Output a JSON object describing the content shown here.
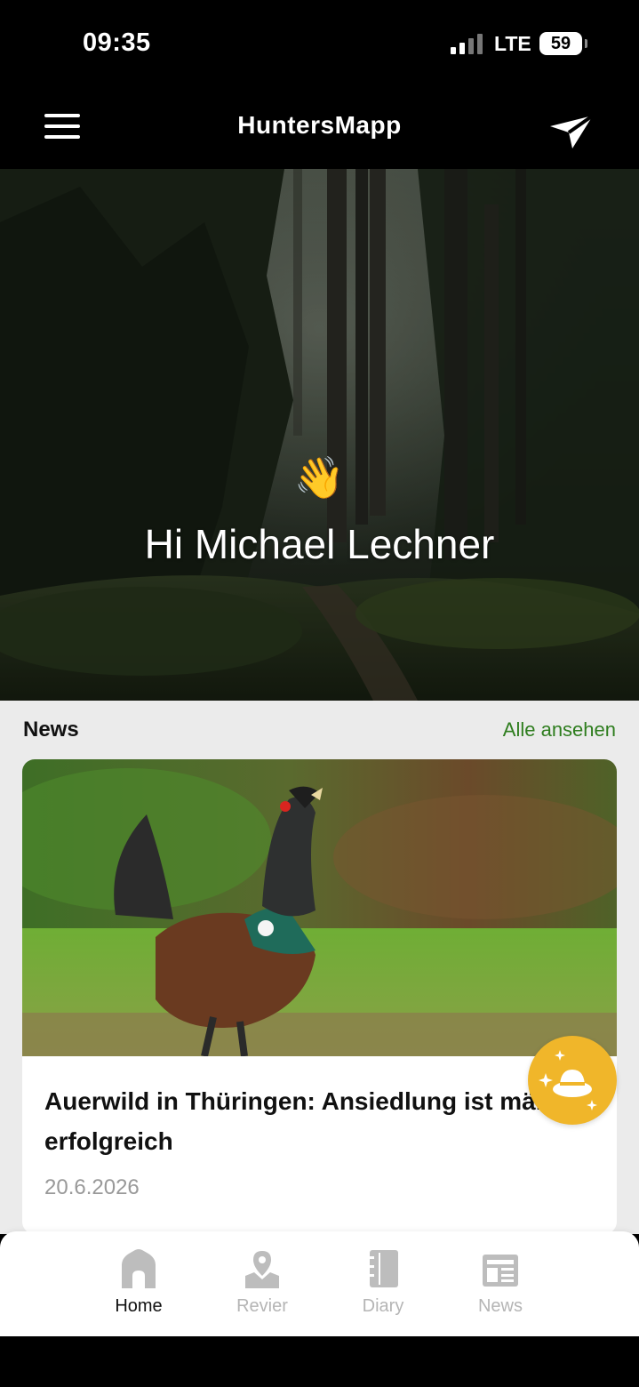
{
  "status_bar": {
    "time": "09:35",
    "network": "LTE",
    "battery": "59"
  },
  "app_bar": {
    "title": "HuntersMapp",
    "menu_icon": "hamburger-menu-icon",
    "send_icon": "paper-plane-icon"
  },
  "hero": {
    "wave_emoji": "👋",
    "greeting": "Hi Michael Lechner"
  },
  "news": {
    "heading": "News",
    "see_all": "Alle ansehen",
    "card": {
      "title": "Auerwild in Thüringen: Ansiedlung ist mäßig erfolgreich",
      "date": "20.6.2026",
      "image": "capercaillie-photo"
    }
  },
  "fab": {
    "icon": "hunter-hat-sparkle-icon"
  },
  "bottom_nav": {
    "items": [
      {
        "label": "Home",
        "icon": "home-icon",
        "active": true
      },
      {
        "label": "Revier",
        "icon": "map-pin-icon",
        "active": false
      },
      {
        "label": "Diary",
        "icon": "notebook-icon",
        "active": false
      },
      {
        "label": "News",
        "icon": "newspaper-icon",
        "active": false
      }
    ]
  },
  "colors": {
    "accent_green": "#2e7d1e",
    "fab_yellow": "#f0b62a"
  }
}
